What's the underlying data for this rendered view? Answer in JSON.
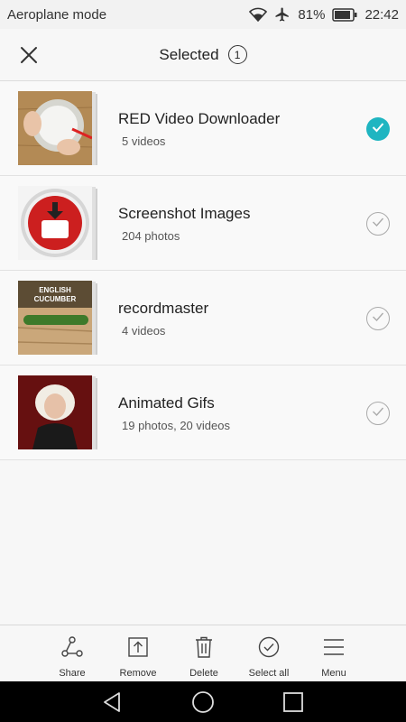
{
  "status_bar": {
    "mode_label": "Aeroplane mode",
    "battery_percent": "81%",
    "time": "22:42"
  },
  "header": {
    "title": "Selected",
    "selected_count": "1"
  },
  "albums": [
    {
      "name": "RED Video Downloader",
      "count": "5 videos",
      "selected": true,
      "thumb_icon": "cooking-bowl-thumbnail"
    },
    {
      "name": "Screenshot Images",
      "count": "204 photos",
      "selected": false,
      "thumb_icon": "download-app-icon-thumbnail"
    },
    {
      "name": "recordmaster",
      "count": "4 videos",
      "selected": false,
      "thumb_icon": "cucumber-thumbnail",
      "thumb_caption": "ENGLISH CUCUMBER"
    },
    {
      "name": "Animated Gifs",
      "count": "19 photos,  20 videos",
      "selected": false,
      "thumb_icon": "person-thumbnail"
    }
  ],
  "toolbar": {
    "share_label": "Share",
    "remove_label": "Remove",
    "delete_label": "Delete",
    "select_all_label": "Select all",
    "menu_label": "Menu"
  },
  "colors": {
    "accent": "#1fb5c1",
    "nav_bar": "#000000"
  }
}
